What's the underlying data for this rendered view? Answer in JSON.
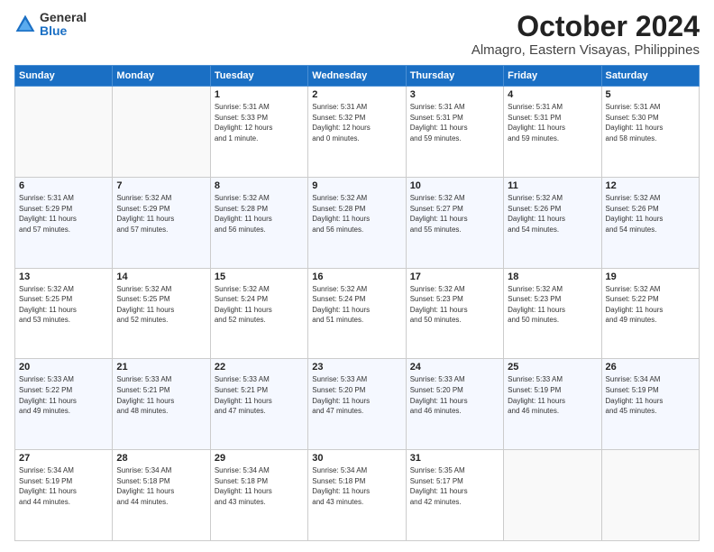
{
  "logo": {
    "general": "General",
    "blue": "Blue"
  },
  "header": {
    "month": "October 2024",
    "location": "Almagro, Eastern Visayas, Philippines"
  },
  "weekdays": [
    "Sunday",
    "Monday",
    "Tuesday",
    "Wednesday",
    "Thursday",
    "Friday",
    "Saturday"
  ],
  "weeks": [
    [
      {
        "day": "",
        "info": ""
      },
      {
        "day": "",
        "info": ""
      },
      {
        "day": "1",
        "info": "Sunrise: 5:31 AM\nSunset: 5:33 PM\nDaylight: 12 hours\nand 1 minute."
      },
      {
        "day": "2",
        "info": "Sunrise: 5:31 AM\nSunset: 5:32 PM\nDaylight: 12 hours\nand 0 minutes."
      },
      {
        "day": "3",
        "info": "Sunrise: 5:31 AM\nSunset: 5:31 PM\nDaylight: 11 hours\nand 59 minutes."
      },
      {
        "day": "4",
        "info": "Sunrise: 5:31 AM\nSunset: 5:31 PM\nDaylight: 11 hours\nand 59 minutes."
      },
      {
        "day": "5",
        "info": "Sunrise: 5:31 AM\nSunset: 5:30 PM\nDaylight: 11 hours\nand 58 minutes."
      }
    ],
    [
      {
        "day": "6",
        "info": "Sunrise: 5:31 AM\nSunset: 5:29 PM\nDaylight: 11 hours\nand 57 minutes."
      },
      {
        "day": "7",
        "info": "Sunrise: 5:32 AM\nSunset: 5:29 PM\nDaylight: 11 hours\nand 57 minutes."
      },
      {
        "day": "8",
        "info": "Sunrise: 5:32 AM\nSunset: 5:28 PM\nDaylight: 11 hours\nand 56 minutes."
      },
      {
        "day": "9",
        "info": "Sunrise: 5:32 AM\nSunset: 5:28 PM\nDaylight: 11 hours\nand 56 minutes."
      },
      {
        "day": "10",
        "info": "Sunrise: 5:32 AM\nSunset: 5:27 PM\nDaylight: 11 hours\nand 55 minutes."
      },
      {
        "day": "11",
        "info": "Sunrise: 5:32 AM\nSunset: 5:26 PM\nDaylight: 11 hours\nand 54 minutes."
      },
      {
        "day": "12",
        "info": "Sunrise: 5:32 AM\nSunset: 5:26 PM\nDaylight: 11 hours\nand 54 minutes."
      }
    ],
    [
      {
        "day": "13",
        "info": "Sunrise: 5:32 AM\nSunset: 5:25 PM\nDaylight: 11 hours\nand 53 minutes."
      },
      {
        "day": "14",
        "info": "Sunrise: 5:32 AM\nSunset: 5:25 PM\nDaylight: 11 hours\nand 52 minutes."
      },
      {
        "day": "15",
        "info": "Sunrise: 5:32 AM\nSunset: 5:24 PM\nDaylight: 11 hours\nand 52 minutes."
      },
      {
        "day": "16",
        "info": "Sunrise: 5:32 AM\nSunset: 5:24 PM\nDaylight: 11 hours\nand 51 minutes."
      },
      {
        "day": "17",
        "info": "Sunrise: 5:32 AM\nSunset: 5:23 PM\nDaylight: 11 hours\nand 50 minutes."
      },
      {
        "day": "18",
        "info": "Sunrise: 5:32 AM\nSunset: 5:23 PM\nDaylight: 11 hours\nand 50 minutes."
      },
      {
        "day": "19",
        "info": "Sunrise: 5:32 AM\nSunset: 5:22 PM\nDaylight: 11 hours\nand 49 minutes."
      }
    ],
    [
      {
        "day": "20",
        "info": "Sunrise: 5:33 AM\nSunset: 5:22 PM\nDaylight: 11 hours\nand 49 minutes."
      },
      {
        "day": "21",
        "info": "Sunrise: 5:33 AM\nSunset: 5:21 PM\nDaylight: 11 hours\nand 48 minutes."
      },
      {
        "day": "22",
        "info": "Sunrise: 5:33 AM\nSunset: 5:21 PM\nDaylight: 11 hours\nand 47 minutes."
      },
      {
        "day": "23",
        "info": "Sunrise: 5:33 AM\nSunset: 5:20 PM\nDaylight: 11 hours\nand 47 minutes."
      },
      {
        "day": "24",
        "info": "Sunrise: 5:33 AM\nSunset: 5:20 PM\nDaylight: 11 hours\nand 46 minutes."
      },
      {
        "day": "25",
        "info": "Sunrise: 5:33 AM\nSunset: 5:19 PM\nDaylight: 11 hours\nand 46 minutes."
      },
      {
        "day": "26",
        "info": "Sunrise: 5:34 AM\nSunset: 5:19 PM\nDaylight: 11 hours\nand 45 minutes."
      }
    ],
    [
      {
        "day": "27",
        "info": "Sunrise: 5:34 AM\nSunset: 5:19 PM\nDaylight: 11 hours\nand 44 minutes."
      },
      {
        "day": "28",
        "info": "Sunrise: 5:34 AM\nSunset: 5:18 PM\nDaylight: 11 hours\nand 44 minutes."
      },
      {
        "day": "29",
        "info": "Sunrise: 5:34 AM\nSunset: 5:18 PM\nDaylight: 11 hours\nand 43 minutes."
      },
      {
        "day": "30",
        "info": "Sunrise: 5:34 AM\nSunset: 5:18 PM\nDaylight: 11 hours\nand 43 minutes."
      },
      {
        "day": "31",
        "info": "Sunrise: 5:35 AM\nSunset: 5:17 PM\nDaylight: 11 hours\nand 42 minutes."
      },
      {
        "day": "",
        "info": ""
      },
      {
        "day": "",
        "info": ""
      }
    ]
  ]
}
